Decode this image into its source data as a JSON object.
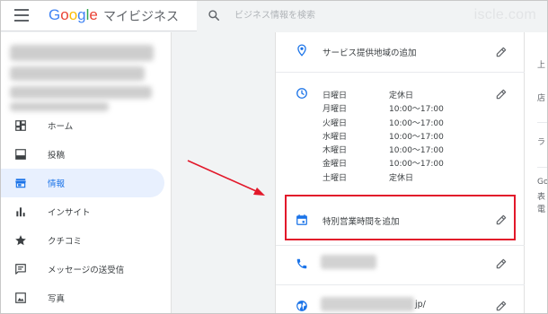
{
  "header": {
    "logo": "Google",
    "product": "マイビジネス",
    "search_placeholder": "ビジネス情報を検索",
    "watermark": "iscle.com"
  },
  "sidebar": {
    "items": [
      {
        "label": "ホーム",
        "icon": "dashboard-icon",
        "active": false
      },
      {
        "label": "投稿",
        "icon": "posts-icon",
        "active": false
      },
      {
        "label": "情報",
        "icon": "storefront-icon",
        "active": true
      },
      {
        "label": "インサイト",
        "icon": "bar-chart-icon",
        "active": false
      },
      {
        "label": "クチコミ",
        "icon": "star-icon",
        "active": false
      },
      {
        "label": "メッセージの送受信",
        "icon": "message-icon",
        "active": false
      },
      {
        "label": "写真",
        "icon": "photo-icon",
        "active": false
      }
    ]
  },
  "info": {
    "service_area_label": "サービス提供地域の追加",
    "hours": [
      {
        "day": "日曜日",
        "time": "定休日"
      },
      {
        "day": "月曜日",
        "time": "10:00～17:00"
      },
      {
        "day": "火曜日",
        "time": "10:00～17:00"
      },
      {
        "day": "水曜日",
        "time": "10:00～17:00"
      },
      {
        "day": "木曜日",
        "time": "10:00～17:00"
      },
      {
        "day": "金曜日",
        "time": "10:00～17:00"
      },
      {
        "day": "土曜日",
        "time": "定休日"
      }
    ],
    "special_hours_label": "特別営業時間を追加",
    "website_suffix": "jp/"
  },
  "right_panel": {
    "snippets": [
      "上",
      "店",
      "ラ",
      "Go",
      "表",
      "電"
    ]
  },
  "colors": {
    "accent": "#1a73e8",
    "highlight_box": "#e2182a",
    "annotation_arrow": "#e2182a",
    "active_bg": "#e8f0fe"
  }
}
